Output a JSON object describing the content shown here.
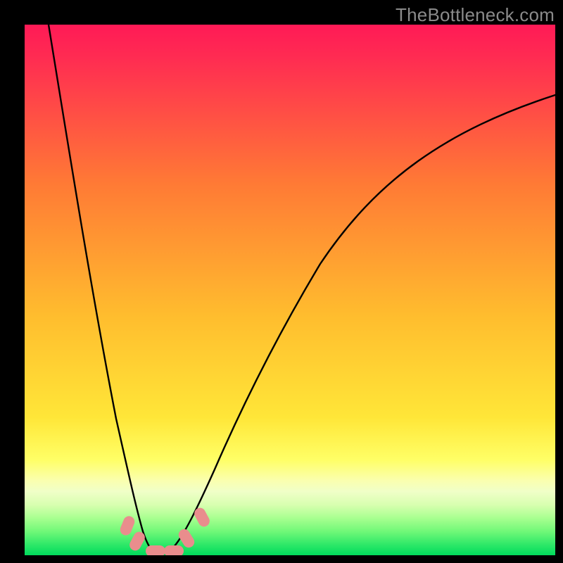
{
  "watermark": "TheBottleneck.com",
  "chart_data": {
    "type": "line",
    "title": "",
    "xlabel": "",
    "ylabel": "",
    "xlim": [
      0,
      1
    ],
    "ylim": [
      0,
      1
    ],
    "background": "heatmap-gradient red→yellow→green (top→bottom)",
    "series": [
      {
        "name": "bottleneck-curve",
        "color": "#000000",
        "x": [
          0.045,
          0.1,
          0.15,
          0.185,
          0.21,
          0.23,
          0.245,
          0.26,
          0.29,
          0.35,
          0.45,
          0.6,
          0.8,
          1.0
        ],
        "y": [
          1.0,
          0.58,
          0.25,
          0.07,
          0.012,
          0.005,
          0.003,
          0.005,
          0.012,
          0.075,
          0.24,
          0.46,
          0.7,
          0.87
        ]
      }
    ],
    "markers": [
      {
        "name": "marker-1",
        "x": 0.195,
        "y": 0.045,
        "shape": "rounded-pill",
        "color": "#e98d8d"
      },
      {
        "name": "marker-2",
        "x": 0.215,
        "y": 0.018,
        "shape": "rounded-pill",
        "color": "#e98d8d"
      },
      {
        "name": "marker-3",
        "x": 0.245,
        "y": 0.004,
        "shape": "rounded-pill",
        "color": "#e98d8d"
      },
      {
        "name": "marker-4",
        "x": 0.275,
        "y": 0.004,
        "shape": "rounded-pill",
        "color": "#e98d8d"
      },
      {
        "name": "marker-5",
        "x": 0.305,
        "y": 0.03,
        "shape": "rounded-pill",
        "color": "#e98d8d"
      },
      {
        "name": "marker-6",
        "x": 0.335,
        "y": 0.065,
        "shape": "rounded-pill",
        "color": "#e98d8d"
      }
    ],
    "colors": {
      "gradient_top": "#ff1a56",
      "gradient_mid1": "#ff8a2a",
      "gradient_mid2": "#ffe638",
      "gradient_low1": "#f9ffa0",
      "gradient_low2": "#b8ff8c",
      "gradient_bottom": "#00e060"
    }
  }
}
